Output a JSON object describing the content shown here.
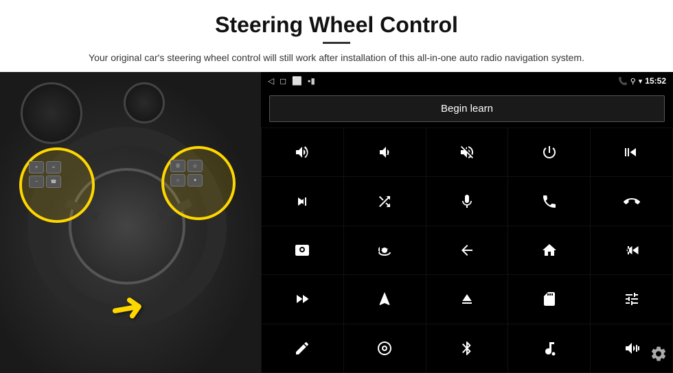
{
  "header": {
    "title": "Steering Wheel Control",
    "subtitle": "Your original car's steering wheel control will still work after installation of this all-in-one auto radio navigation system.",
    "divider": true
  },
  "status_bar": {
    "nav_back": "◁",
    "nav_home": "□",
    "nav_recent": "⊡",
    "signal_icon": "▪▪",
    "phone_icon": "📞",
    "location_icon": "⚲",
    "wifi_icon": "▾",
    "time": "15:52"
  },
  "begin_learn": {
    "label": "Begin learn"
  },
  "controls": [
    {
      "icon": "vol_up",
      "unicode": "🔊+",
      "svg_type": "vol-up"
    },
    {
      "icon": "vol_down",
      "unicode": "🔉-",
      "svg_type": "vol-down"
    },
    {
      "icon": "mute",
      "unicode": "🔇",
      "svg_type": "mute"
    },
    {
      "icon": "power",
      "unicode": "⏻",
      "svg_type": "power"
    },
    {
      "icon": "prev_track",
      "unicode": "⏮",
      "svg_type": "prev"
    },
    {
      "icon": "skip_forward",
      "unicode": "⏭",
      "svg_type": "next"
    },
    {
      "icon": "shuffle",
      "unicode": "⇌⏭",
      "svg_type": "shuffle"
    },
    {
      "icon": "mic",
      "unicode": "🎤",
      "svg_type": "mic"
    },
    {
      "icon": "phone",
      "unicode": "📞",
      "svg_type": "phone"
    },
    {
      "icon": "hang_up",
      "unicode": "📵",
      "svg_type": "hangup"
    },
    {
      "icon": "car_horn",
      "unicode": "📯",
      "svg_type": "horn"
    },
    {
      "icon": "360_camera",
      "unicode": "👁",
      "svg_type": "camera360"
    },
    {
      "icon": "back",
      "unicode": "↩",
      "svg_type": "back"
    },
    {
      "icon": "home",
      "unicode": "⌂",
      "svg_type": "home"
    },
    {
      "icon": "skip_back",
      "unicode": "⏮⏮",
      "svg_type": "skip-back"
    },
    {
      "icon": "fast_forward",
      "unicode": "⏭⏭",
      "svg_type": "ff"
    },
    {
      "icon": "navigate",
      "unicode": "▶",
      "svg_type": "nav"
    },
    {
      "icon": "eject",
      "unicode": "⏏",
      "svg_type": "eject"
    },
    {
      "icon": "sd_card",
      "unicode": "💾",
      "svg_type": "sdcard"
    },
    {
      "icon": "equalizer",
      "unicode": "⚙",
      "svg_type": "eq"
    },
    {
      "icon": "pen",
      "unicode": "✏",
      "svg_type": "pen"
    },
    {
      "icon": "target",
      "unicode": "🎯",
      "svg_type": "target"
    },
    {
      "icon": "bluetooth",
      "unicode": "✦",
      "svg_type": "bluetooth"
    },
    {
      "icon": "music_settings",
      "unicode": "🎵",
      "svg_type": "music"
    },
    {
      "icon": "waveform",
      "unicode": "▐▌",
      "svg_type": "waveform"
    }
  ],
  "settings_icon": "⚙"
}
